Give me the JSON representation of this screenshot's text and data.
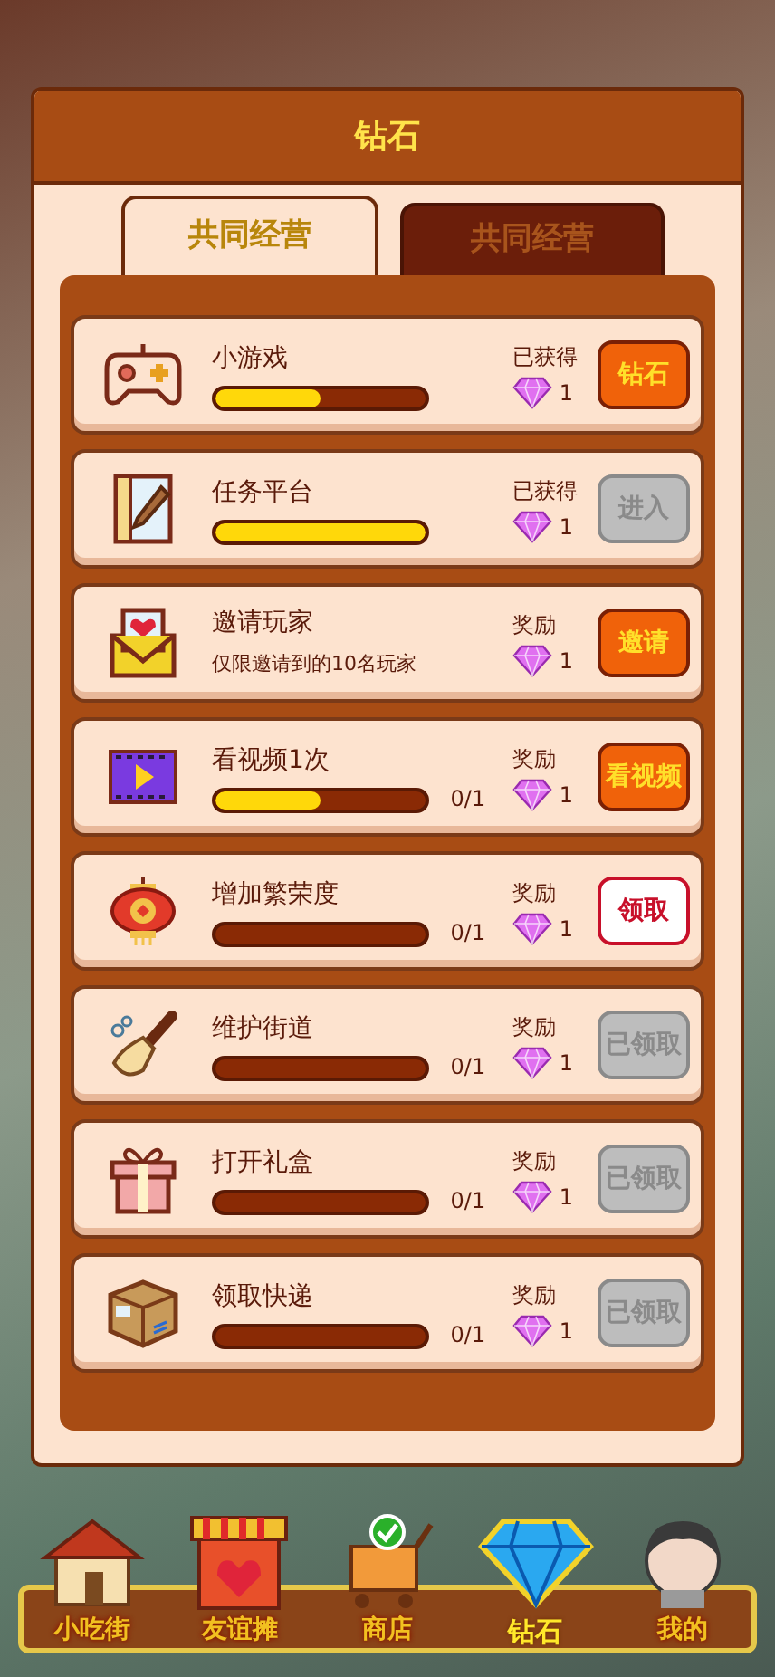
{
  "panel": {
    "title": "钻石"
  },
  "tabs": [
    {
      "label": "共同经营",
      "selected": true
    },
    {
      "label": "共同经营",
      "selected": false
    }
  ],
  "tasks": [
    {
      "title": "小游戏",
      "level": 0.5,
      "reward_label": "已获得",
      "reward": "1",
      "button": {
        "label": "钻石",
        "kind": "orange"
      }
    },
    {
      "title": "任务平台",
      "level": 1,
      "reward_label": "已获得",
      "reward": "1",
      "button": {
        "label": "进入",
        "kind": "gray"
      }
    },
    {
      "title": "邀请玩家",
      "subtitle": "仅限邀请到的10名玩家",
      "reward_label": "奖励",
      "reward": "1",
      "button": {
        "label": "邀请",
        "kind": "orange"
      }
    },
    {
      "title": "看视频1次",
      "level": 0.5,
      "progress": "0/1",
      "reward_label": "奖励",
      "reward": "1",
      "button": {
        "label": "看视频",
        "kind": "orange"
      }
    },
    {
      "title": "增加繁荣度",
      "level": 0,
      "progress": "0/1",
      "reward_label": "奖励",
      "reward": "1",
      "button": {
        "label": "领取",
        "kind": "white"
      }
    },
    {
      "title": "维护街道",
      "level": 0,
      "progress": "0/1",
      "reward_label": "奖励",
      "reward": "1",
      "button": {
        "label": "已领取",
        "kind": "gray"
      }
    },
    {
      "title": "打开礼盒",
      "level": 0,
      "progress": "0/1",
      "reward_label": "奖励",
      "reward": "1",
      "button": {
        "label": "已领取",
        "kind": "gray"
      }
    },
    {
      "title": "领取快递",
      "level": 0,
      "progress": "0/1",
      "reward_label": "奖励",
      "reward": "1",
      "button": {
        "label": "已领取",
        "kind": "gray"
      }
    }
  ],
  "nav": [
    {
      "label": "小吃街",
      "selected": false
    },
    {
      "label": "友谊摊",
      "selected": false
    },
    {
      "label": "商店",
      "selected": false
    },
    {
      "label": "钻石",
      "selected": true
    },
    {
      "label": "我的",
      "selected": false
    }
  ]
}
